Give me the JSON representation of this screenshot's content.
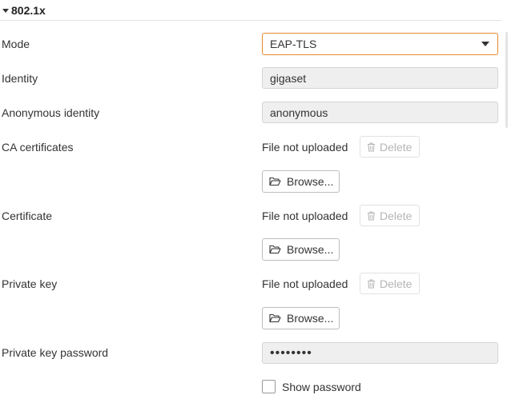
{
  "section": {
    "title": "802.1x"
  },
  "fields": {
    "mode": {
      "label": "Mode",
      "value": "EAP-TLS"
    },
    "identity": {
      "label": "Identity",
      "value": "gigaset"
    },
    "anonymous_identity": {
      "label": "Anonymous identity",
      "value": "anonymous"
    },
    "ca_certificates": {
      "label": "CA certificates",
      "status": "File not uploaded",
      "delete_label": "Delete",
      "browse_label": "Browse..."
    },
    "certificate": {
      "label": "Certificate",
      "status": "File not uploaded",
      "delete_label": "Delete",
      "browse_label": "Browse..."
    },
    "private_key": {
      "label": "Private key",
      "status": "File not uploaded",
      "delete_label": "Delete",
      "browse_label": "Browse..."
    },
    "private_key_password": {
      "label": "Private key password",
      "value": "••••••••"
    },
    "show_password": {
      "label": "Show password",
      "checked": false
    }
  },
  "icons": {
    "section_toggle": "triangle-down-icon",
    "select_caret": "chevron-down-icon",
    "delete": "trash-icon",
    "browse": "folder-open-icon"
  },
  "colors": {
    "focus_border": "#e6892e",
    "disabled_text": "#b5b5b5",
    "input_background": "#efefef"
  }
}
